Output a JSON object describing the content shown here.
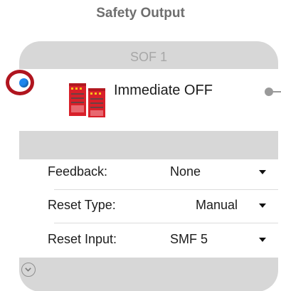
{
  "block": {
    "title": "Safety Output",
    "instance_name": "SOF 1",
    "function_label": "Immediate OFF"
  },
  "settings": [
    {
      "label": "Feedback:",
      "value": "None"
    },
    {
      "label": "Reset Type:",
      "value": "Manual"
    },
    {
      "label": "Reset Input:",
      "value": "SMF 5"
    }
  ],
  "icons": {
    "function": "relay-contactor-icon",
    "input": "input-connector-icon",
    "output": "output-connector-icon",
    "expand": "chevron-down-icon"
  },
  "colors": {
    "card_background": "#d7d7d7",
    "title_text": "#6e6e6e",
    "instance_text": "#a7a7a7",
    "input_dot": "#1f86ee",
    "highlight_ring": "#b0151f",
    "relay_red": "#d8202a"
  }
}
